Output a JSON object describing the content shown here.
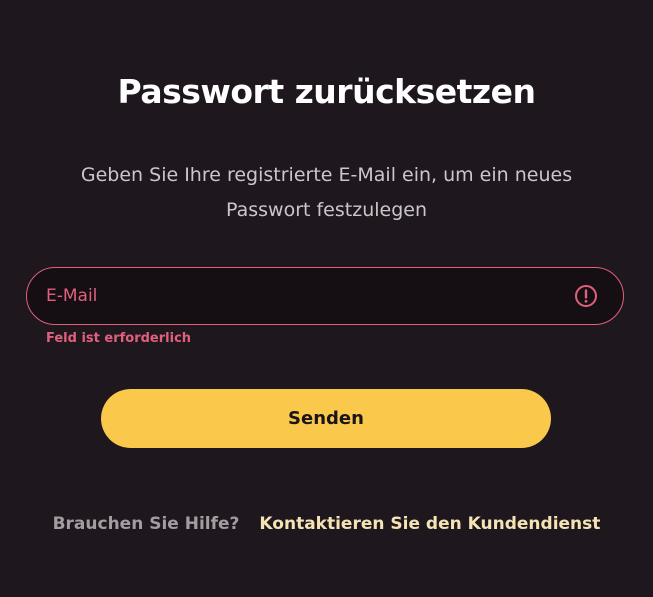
{
  "header": {
    "title": "Passwort zurücksetzen",
    "subtitle_line1": "Geben Sie Ihre registrierte E-Mail ein, um ein neues",
    "subtitle_line2": "Passwort festzulegen"
  },
  "form": {
    "email": {
      "placeholder": "E-Mail",
      "value": "",
      "error_icon": "alert-circle-icon",
      "error_message": "Feld ist erforderlich"
    },
    "submit_label": "Senden"
  },
  "help": {
    "question": "Brauchen Sie Hilfe?",
    "link_label": "Kontaktieren Sie den Kundendienst"
  },
  "colors": {
    "background": "#1e171d",
    "field_background": "#150e13",
    "error": "#e0607e",
    "accent": "#fac94b",
    "link": "#f6e3b5",
    "muted_text": "#a39da2"
  }
}
